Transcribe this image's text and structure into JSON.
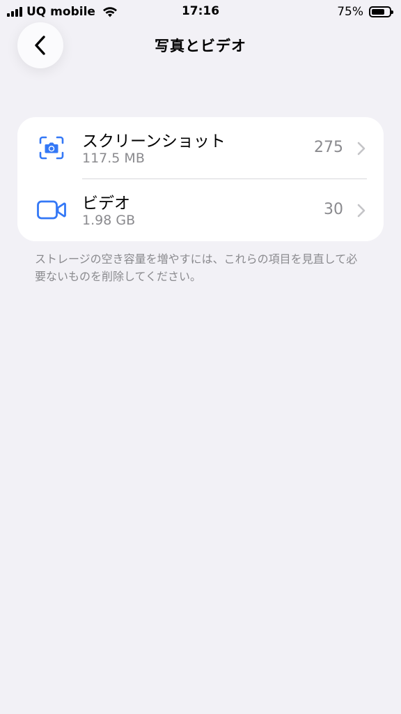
{
  "status_bar": {
    "carrier": "UQ mobile",
    "time": "17:16",
    "battery_percent": "75%",
    "battery_level": 0.75
  },
  "nav": {
    "title": "写真とビデオ"
  },
  "list": {
    "items": [
      {
        "title": "スクリーンショット",
        "size": "117.5 MB",
        "count": "275",
        "icon": "screenshot-icon"
      },
      {
        "title": "ビデオ",
        "size": "1.98 GB",
        "count": "30",
        "icon": "video-camera-icon"
      }
    ]
  },
  "footnote": "ストレージの空き容量を増やすには、これらの項目を見直して必要ないものを削除してください。",
  "colors": {
    "accent": "#3478f6",
    "background": "#f2f1f6",
    "secondary_text": "#8a8a8e"
  }
}
